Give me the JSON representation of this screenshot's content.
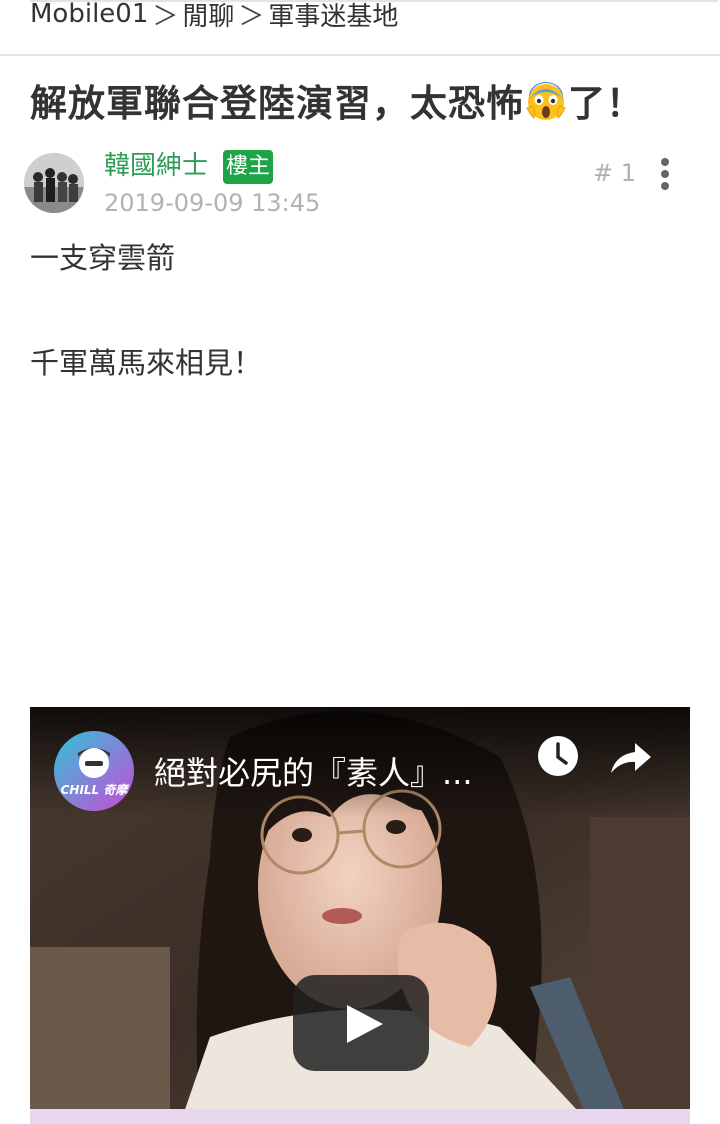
{
  "breadcrumb": {
    "items": [
      "Mobile01",
      "閒聊",
      "軍事迷基地"
    ],
    "separator": "＞"
  },
  "post": {
    "title": "解放軍聯合登陸演習，太恐怖",
    "title_emoji": "face-screaming-in-fear",
    "title_suffix": "了！",
    "author": "韓國紳士",
    "op_badge": "樓主",
    "date": "2019-09-09 13:45",
    "floor": "# 1",
    "body": [
      "一支穿雲箭",
      "千軍萬馬來相見！"
    ]
  },
  "video": {
    "title": "絕對必尻的『素人』...",
    "channel_logo_text": "CHILL 奇摩",
    "icons": [
      "clock-icon",
      "share-icon",
      "play-icon"
    ]
  },
  "colors": {
    "author": "#2f9d57",
    "badge": "#1ea347",
    "meta": "#b2b2b2",
    "text": "#333333"
  }
}
